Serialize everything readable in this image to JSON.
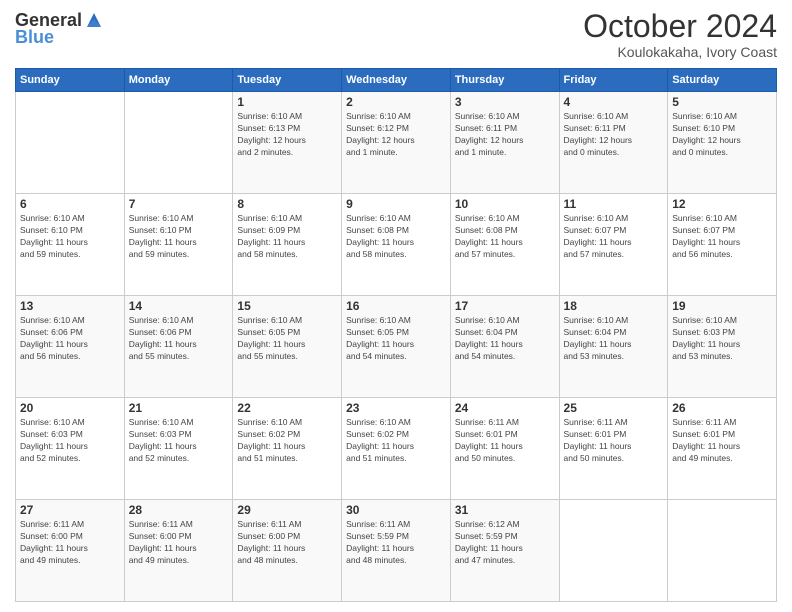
{
  "header": {
    "logo": {
      "general": "General",
      "blue": "Blue"
    },
    "title": "October 2024",
    "location": "Koulokakaha, Ivory Coast"
  },
  "calendar": {
    "days_of_week": [
      "Sunday",
      "Monday",
      "Tuesday",
      "Wednesday",
      "Thursday",
      "Friday",
      "Saturday"
    ],
    "weeks": [
      [
        {
          "day": "",
          "info": ""
        },
        {
          "day": "",
          "info": ""
        },
        {
          "day": "1",
          "info": "Sunrise: 6:10 AM\nSunset: 6:13 PM\nDaylight: 12 hours\nand 2 minutes."
        },
        {
          "day": "2",
          "info": "Sunrise: 6:10 AM\nSunset: 6:12 PM\nDaylight: 12 hours\nand 1 minute."
        },
        {
          "day": "3",
          "info": "Sunrise: 6:10 AM\nSunset: 6:11 PM\nDaylight: 12 hours\nand 1 minute."
        },
        {
          "day": "4",
          "info": "Sunrise: 6:10 AM\nSunset: 6:11 PM\nDaylight: 12 hours\nand 0 minutes."
        },
        {
          "day": "5",
          "info": "Sunrise: 6:10 AM\nSunset: 6:10 PM\nDaylight: 12 hours\nand 0 minutes."
        }
      ],
      [
        {
          "day": "6",
          "info": "Sunrise: 6:10 AM\nSunset: 6:10 PM\nDaylight: 11 hours\nand 59 minutes."
        },
        {
          "day": "7",
          "info": "Sunrise: 6:10 AM\nSunset: 6:10 PM\nDaylight: 11 hours\nand 59 minutes."
        },
        {
          "day": "8",
          "info": "Sunrise: 6:10 AM\nSunset: 6:09 PM\nDaylight: 11 hours\nand 58 minutes."
        },
        {
          "day": "9",
          "info": "Sunrise: 6:10 AM\nSunset: 6:08 PM\nDaylight: 11 hours\nand 58 minutes."
        },
        {
          "day": "10",
          "info": "Sunrise: 6:10 AM\nSunset: 6:08 PM\nDaylight: 11 hours\nand 57 minutes."
        },
        {
          "day": "11",
          "info": "Sunrise: 6:10 AM\nSunset: 6:07 PM\nDaylight: 11 hours\nand 57 minutes."
        },
        {
          "day": "12",
          "info": "Sunrise: 6:10 AM\nSunset: 6:07 PM\nDaylight: 11 hours\nand 56 minutes."
        }
      ],
      [
        {
          "day": "13",
          "info": "Sunrise: 6:10 AM\nSunset: 6:06 PM\nDaylight: 11 hours\nand 56 minutes."
        },
        {
          "day": "14",
          "info": "Sunrise: 6:10 AM\nSunset: 6:06 PM\nDaylight: 11 hours\nand 55 minutes."
        },
        {
          "day": "15",
          "info": "Sunrise: 6:10 AM\nSunset: 6:05 PM\nDaylight: 11 hours\nand 55 minutes."
        },
        {
          "day": "16",
          "info": "Sunrise: 6:10 AM\nSunset: 6:05 PM\nDaylight: 11 hours\nand 54 minutes."
        },
        {
          "day": "17",
          "info": "Sunrise: 6:10 AM\nSunset: 6:04 PM\nDaylight: 11 hours\nand 54 minutes."
        },
        {
          "day": "18",
          "info": "Sunrise: 6:10 AM\nSunset: 6:04 PM\nDaylight: 11 hours\nand 53 minutes."
        },
        {
          "day": "19",
          "info": "Sunrise: 6:10 AM\nSunset: 6:03 PM\nDaylight: 11 hours\nand 53 minutes."
        }
      ],
      [
        {
          "day": "20",
          "info": "Sunrise: 6:10 AM\nSunset: 6:03 PM\nDaylight: 11 hours\nand 52 minutes."
        },
        {
          "day": "21",
          "info": "Sunrise: 6:10 AM\nSunset: 6:03 PM\nDaylight: 11 hours\nand 52 minutes."
        },
        {
          "day": "22",
          "info": "Sunrise: 6:10 AM\nSunset: 6:02 PM\nDaylight: 11 hours\nand 51 minutes."
        },
        {
          "day": "23",
          "info": "Sunrise: 6:10 AM\nSunset: 6:02 PM\nDaylight: 11 hours\nand 51 minutes."
        },
        {
          "day": "24",
          "info": "Sunrise: 6:11 AM\nSunset: 6:01 PM\nDaylight: 11 hours\nand 50 minutes."
        },
        {
          "day": "25",
          "info": "Sunrise: 6:11 AM\nSunset: 6:01 PM\nDaylight: 11 hours\nand 50 minutes."
        },
        {
          "day": "26",
          "info": "Sunrise: 6:11 AM\nSunset: 6:01 PM\nDaylight: 11 hours\nand 49 minutes."
        }
      ],
      [
        {
          "day": "27",
          "info": "Sunrise: 6:11 AM\nSunset: 6:00 PM\nDaylight: 11 hours\nand 49 minutes."
        },
        {
          "day": "28",
          "info": "Sunrise: 6:11 AM\nSunset: 6:00 PM\nDaylight: 11 hours\nand 49 minutes."
        },
        {
          "day": "29",
          "info": "Sunrise: 6:11 AM\nSunset: 6:00 PM\nDaylight: 11 hours\nand 48 minutes."
        },
        {
          "day": "30",
          "info": "Sunrise: 6:11 AM\nSunset: 5:59 PM\nDaylight: 11 hours\nand 48 minutes."
        },
        {
          "day": "31",
          "info": "Sunrise: 6:12 AM\nSunset: 5:59 PM\nDaylight: 11 hours\nand 47 minutes."
        },
        {
          "day": "",
          "info": ""
        },
        {
          "day": "",
          "info": ""
        }
      ]
    ]
  }
}
